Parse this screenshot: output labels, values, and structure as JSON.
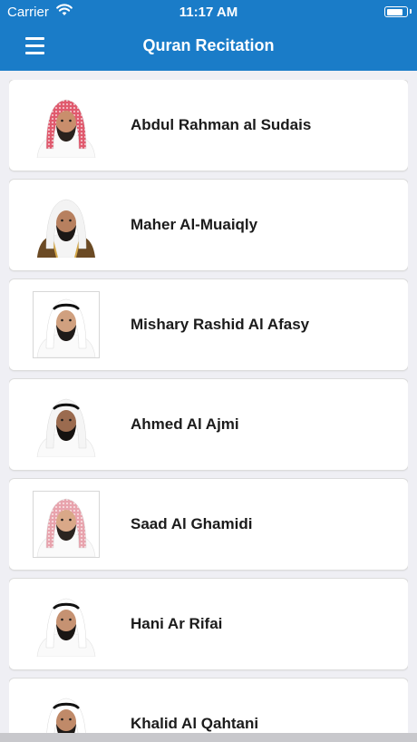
{
  "status_bar": {
    "carrier": "Carrier",
    "time": "11:17 AM",
    "battery_level": 0.85
  },
  "header": {
    "title": "Quran Recitation",
    "menu_icon": "hamburger-menu-icon",
    "background": "#1a7cc8"
  },
  "reciters": [
    {
      "name": "Abdul Rahman al Sudais",
      "photo": "reciter-photo-red-shemagh",
      "headwear": "#e05a6e",
      "skin": "#c98e6c",
      "beard": "#2a221d"
    },
    {
      "name": "Maher Al-Muaiqly",
      "photo": "reciter-photo-white-ghutra-gold-bisht",
      "headwear": "#f3f3f3",
      "skin": "#b7805f",
      "beard": "#1c1816"
    },
    {
      "name": "Mishary Rashid Al Afasy",
      "photo": "reciter-photo-white-ghutra-black-agal",
      "headwear": "#ffffff",
      "skin": "#d0a07f",
      "beard": "#1e1a18"
    },
    {
      "name": "Ahmed Al Ajmi",
      "photo": "reciter-photo-white-ghutra-black-agal",
      "headwear": "#f5f5f5",
      "skin": "#9b6b4f",
      "beard": "#151210"
    },
    {
      "name": "Saad Al Ghamidi",
      "photo": "reciter-photo-pink-shemagh",
      "headwear": "#e8a3ad",
      "skin": "#d9a888",
      "beard": "#2b2420"
    },
    {
      "name": "Hani Ar Rifai",
      "photo": "reciter-photo-white-ghutra-black-agal",
      "headwear": "#ffffff",
      "skin": "#c69272",
      "beard": "#1a1614"
    },
    {
      "name": "Khalid Al Qahtani",
      "photo": "reciter-photo-white-ghutra-black-agal",
      "headwear": "#ffffff",
      "skin": "#c08a69",
      "beard": "#1d1917"
    }
  ]
}
